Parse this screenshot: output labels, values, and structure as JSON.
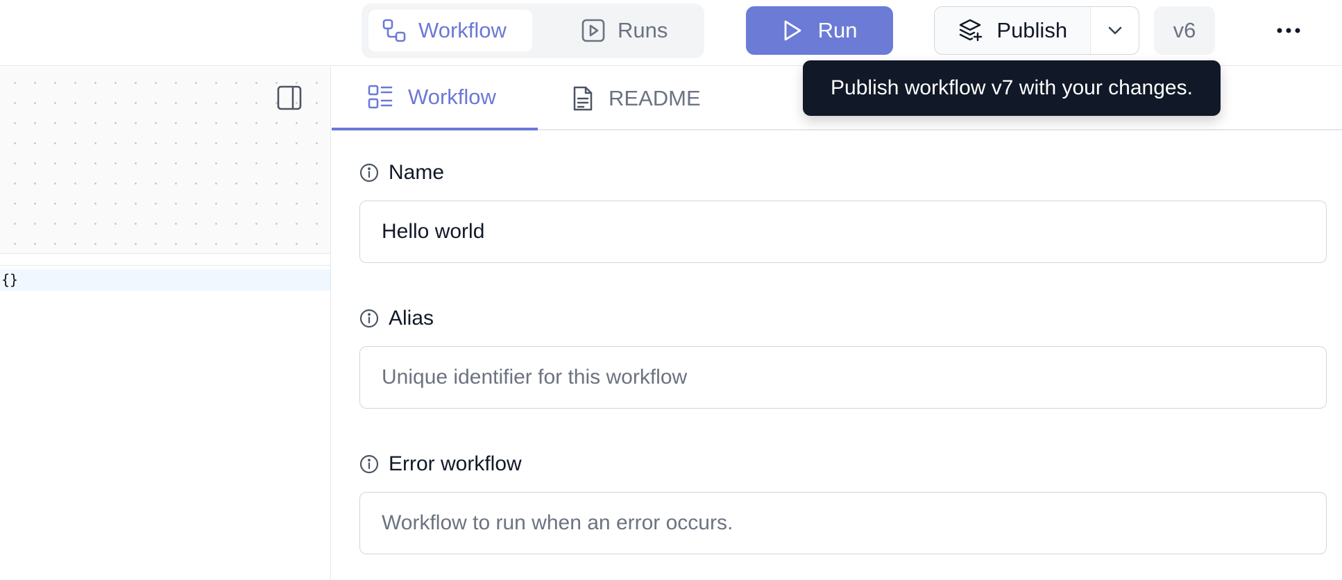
{
  "topbar": {
    "view_toggle": [
      {
        "label": "Workflow",
        "active": true,
        "icon": "workflow-nodes-icon"
      },
      {
        "label": "Runs",
        "active": false,
        "icon": "play-square-icon"
      }
    ],
    "run_label": "Run",
    "publish_label": "Publish",
    "version_label": "v6",
    "more_icon": "more-horizontal-icon"
  },
  "tooltip": {
    "text": "Publish workflow v7 with your changes."
  },
  "left_panel": {
    "json_preview": "{}"
  },
  "tabs": [
    {
      "label": "Workflow",
      "active": true,
      "icon": "list-layout-icon"
    },
    {
      "label": "README",
      "active": false,
      "icon": "document-icon"
    }
  ],
  "form": {
    "name": {
      "label": "Name",
      "value": "Hello world",
      "placeholder": ""
    },
    "alias": {
      "label": "Alias",
      "value": "",
      "placeholder": "Unique identifier for this workflow"
    },
    "error_workflow": {
      "label": "Error workflow",
      "value": "",
      "placeholder": "Workflow to run when an error occurs."
    }
  },
  "colors": {
    "accent": "#6b78d6",
    "run_button": "#6b7bd6",
    "tooltip_bg": "#111827"
  }
}
